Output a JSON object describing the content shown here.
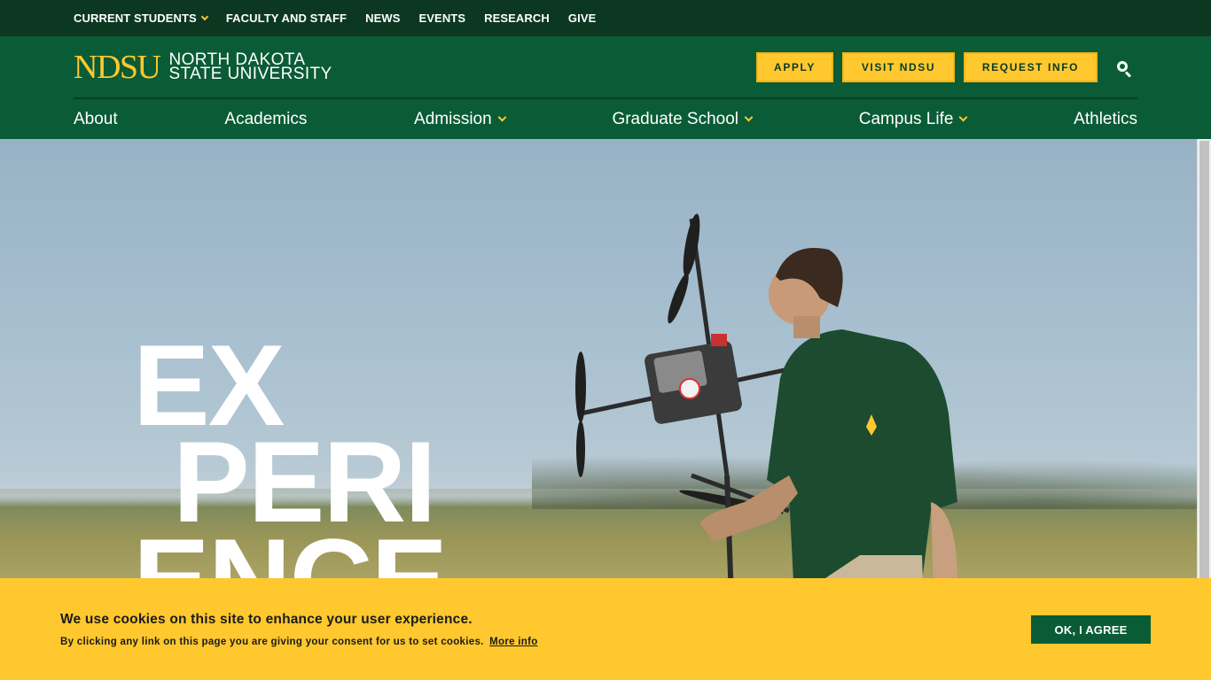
{
  "utility_nav": {
    "items": [
      {
        "label": "CURRENT STUDENTS",
        "has_dropdown": true
      },
      {
        "label": "FACULTY AND STAFF"
      },
      {
        "label": "NEWS"
      },
      {
        "label": "EVENTS"
      },
      {
        "label": "RESEARCH"
      },
      {
        "label": "GIVE"
      }
    ]
  },
  "logo": {
    "mark": "NDSU",
    "line1": "NORTH DAKOTA",
    "line2": "STATE UNIVERSITY"
  },
  "cta": {
    "apply": "APPLY",
    "visit": "VISIT NDSU",
    "request_info": "REQUEST INFO"
  },
  "search": {
    "icon": "search-icon"
  },
  "main_nav": {
    "items": [
      {
        "label": "About"
      },
      {
        "label": "Academics"
      },
      {
        "label": "Admission",
        "has_dropdown": true
      },
      {
        "label": "Graduate School",
        "has_dropdown": true
      },
      {
        "label": "Campus Life",
        "has_dropdown": true
      },
      {
        "label": "Athletics"
      }
    ]
  },
  "hero": {
    "word_line1": "EX",
    "word_line2": "PERI",
    "word_line3": "ENCE"
  },
  "cookie": {
    "title": "We use cookies on this site to enhance your user experience.",
    "text": "By clicking any link on this page you are giving your consent for us to set cookies.",
    "more_link": "More info",
    "agree_button": "OK, I AGREE"
  },
  "colors": {
    "brand_green": "#0a5c36",
    "dark_green": "#0c3822",
    "brand_yellow": "#ffc82e"
  }
}
